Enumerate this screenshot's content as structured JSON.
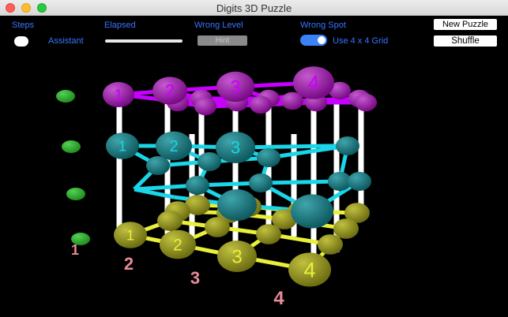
{
  "window": {
    "title": "Digits 3D Puzzle"
  },
  "controls": {
    "steps_label": "Steps",
    "elapsed_label": "Elapsed",
    "wrong_level_label": "Wrong Level",
    "wrong_spot_label": "Wrong Spot",
    "assistant_label": "Assistant",
    "hint_label": "Hint",
    "grid_label": "Use  4 x 4 Grid",
    "new_puzzle_label": "New Puzzle",
    "shuffle_label": "Shuffle"
  },
  "scene": {
    "top_level_front_digits": [
      "1",
      "2",
      "3",
      "4"
    ],
    "mid_level_front_digits": [
      "1",
      "2",
      "3"
    ],
    "bottom_level_front_digits": [
      "1",
      "2",
      "3",
      "4"
    ],
    "floor_digits": [
      "1",
      "2",
      "3",
      "4"
    ],
    "colors": {
      "top_sphere": "#7a0a86",
      "top_link": "#c800ff",
      "mid_sphere": "#0e5a60",
      "mid_link": "#1ad6e8",
      "bottom_sphere": "#6e6e12",
      "bottom_link": "#e8f03a",
      "marker": "#1f8f1f",
      "floor_digit": "#e88a9a"
    }
  }
}
